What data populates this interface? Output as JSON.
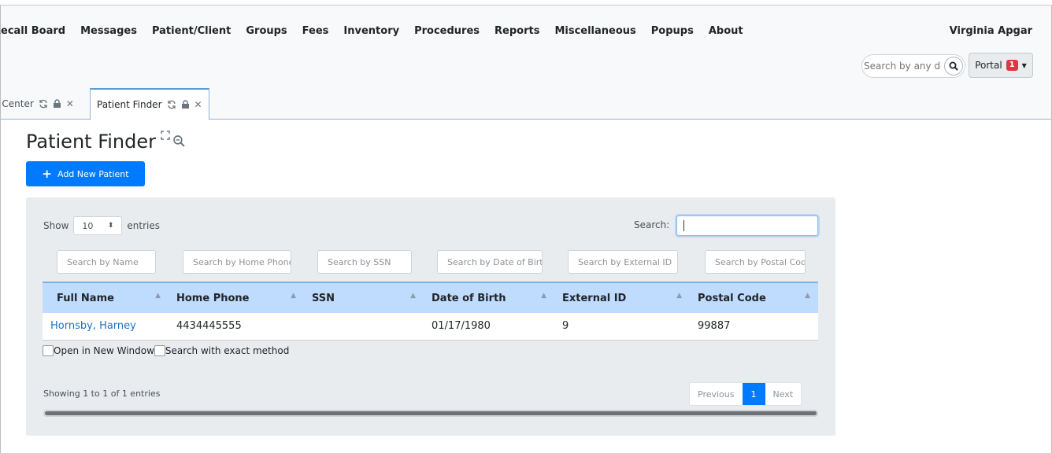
{
  "menu": [
    "Recall Board",
    "Messages",
    "Patient/Client",
    "Groups",
    "Fees",
    "Inventory",
    "Procedures",
    "Reports",
    "Miscellaneous",
    "Popups",
    "About"
  ],
  "user": "Virginia Apgar",
  "search": {
    "placeholder": "Search by any demographics"
  },
  "portal": {
    "label": "Portal",
    "badge": "1"
  },
  "tabs": [
    {
      "label": "Message Center"
    },
    {
      "label": "Patient Finder"
    }
  ],
  "page": {
    "title": "Patient Finder",
    "add_button": "Add New Patient"
  },
  "table_controls": {
    "show_label": "Show",
    "page_size": "10",
    "entries_label": "entries",
    "search_label": "Search:"
  },
  "column_filters": [
    "Search by Name",
    "Search by Home Phone",
    "Search by SSN",
    "Search by Date of Birth",
    "Search by External ID",
    "Search by Postal Code"
  ],
  "columns": [
    "Full Name",
    "Home Phone",
    "SSN",
    "Date of Birth",
    "External ID",
    "Postal Code"
  ],
  "rows": [
    {
      "full_name": "Hornsby, Harney",
      "home_phone": "4434445555",
      "ssn": "",
      "dob": "01/17/1980",
      "external_id": "9",
      "postal_code": "99887"
    }
  ],
  "options": {
    "open_new_window": "Open in New Window",
    "exact_method": "Search with exact method"
  },
  "footer": {
    "showing": "Showing 1 to 1 of 1 entries",
    "previous": "Previous",
    "page": "1",
    "next": "Next"
  },
  "colors": {
    "primary": "#007bff",
    "header_bg": "#bfdcff",
    "badge": "#dc3545"
  }
}
